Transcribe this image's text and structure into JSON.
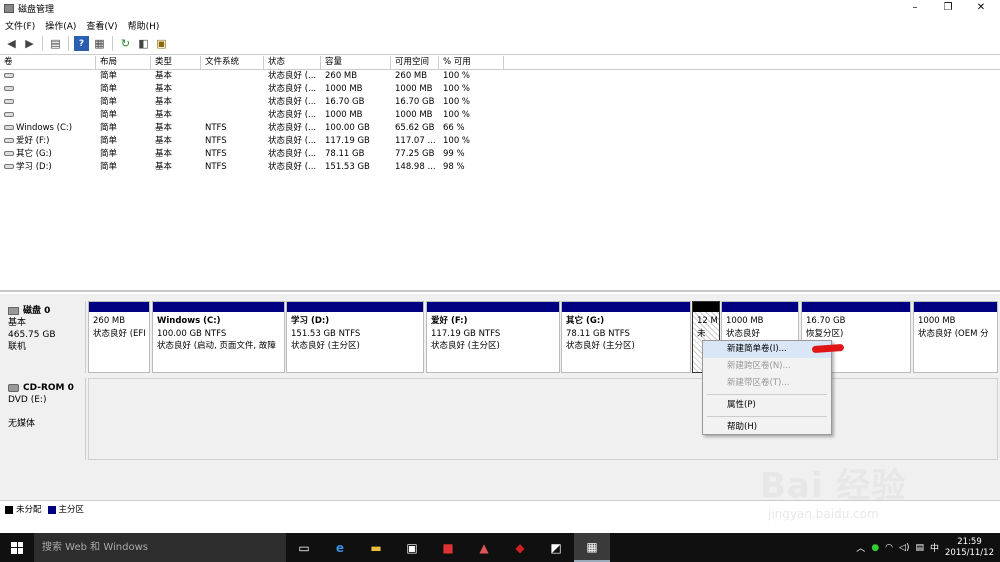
{
  "window": {
    "title": "磁盘管理",
    "minimize": "–",
    "maximize": "❐",
    "close": "✕"
  },
  "menu": [
    "文件(F)",
    "操作(A)",
    "查看(V)",
    "帮助(H)"
  ],
  "table": {
    "headers": [
      "卷",
      "布局",
      "类型",
      "文件系统",
      "状态",
      "容量",
      "可用空间",
      "% 可用"
    ],
    "rows": [
      [
        "",
        "简单",
        "基本",
        "",
        "状态良好 (...",
        "260 MB",
        "260 MB",
        "100 %"
      ],
      [
        "",
        "简单",
        "基本",
        "",
        "状态良好 (...",
        "1000 MB",
        "1000 MB",
        "100 %"
      ],
      [
        "",
        "简单",
        "基本",
        "",
        "状态良好 (...",
        "16.70 GB",
        "16.70 GB",
        "100 %"
      ],
      [
        "",
        "简单",
        "基本",
        "",
        "状态良好 (...",
        "1000 MB",
        "1000 MB",
        "100 %"
      ],
      [
        "Windows (C:)",
        "简单",
        "基本",
        "NTFS",
        "状态良好 (...",
        "100.00 GB",
        "65.62 GB",
        "66 %"
      ],
      [
        "爱好 (F:)",
        "简单",
        "基本",
        "NTFS",
        "状态良好 (...",
        "117.19 GB",
        "117.07 ...",
        "100 %"
      ],
      [
        "其它 (G:)",
        "简单",
        "基本",
        "NTFS",
        "状态良好 (...",
        "78.11 GB",
        "77.25 GB",
        "99 %"
      ],
      [
        "学习 (D:)",
        "简单",
        "基本",
        "NTFS",
        "状态良好 (...",
        "151.53 GB",
        "148.98 ...",
        "98 %"
      ]
    ]
  },
  "disk0": {
    "name": "磁盘 0",
    "type": "基本",
    "size": "465.75 GB",
    "status": "联机",
    "partitions": [
      {
        "label": "",
        "size": "260 MB",
        "status": "状态良好 (EFI"
      },
      {
        "label": "Windows  (C:)",
        "size": "100.00 GB NTFS",
        "status": "状态良好 (启动, 页面文件, 故障"
      },
      {
        "label": "学习  (D:)",
        "size": "151.53 GB NTFS",
        "status": "状态良好 (主分区)"
      },
      {
        "label": "爱好  (F:)",
        "size": "117.19 GB NTFS",
        "status": "状态良好 (主分区)"
      },
      {
        "label": "其它  (G:)",
        "size": "78.11 GB NTFS",
        "status": "状态良好 (主分区)"
      },
      {
        "label": "",
        "size": "12 M",
        "status": "未"
      },
      {
        "label": "",
        "size": "1000 MB",
        "status": "状态良好"
      },
      {
        "label": "",
        "size": "16.70 GB",
        "status": "恢复分区)"
      },
      {
        "label": "",
        "size": "1000 MB",
        "status": "状态良好 (OEM 分"
      }
    ]
  },
  "cdrom": {
    "name": "CD-ROM 0",
    "drive": "DVD (E:)",
    "status": "无媒体"
  },
  "legend": {
    "unallocated": "未分配",
    "primary": "主分区",
    "unalloc_color": "#000000",
    "primary_color": "#000080"
  },
  "context_menu": [
    {
      "label": "新建简单卷(I)...",
      "state": "highlighted"
    },
    {
      "label": "新建跨区卷(N)...",
      "state": "disabled"
    },
    {
      "label": "新建带区卷(T)...",
      "state": "disabled"
    },
    {
      "label": "属性(P)",
      "state": "normal"
    },
    {
      "label": "帮助(H)",
      "state": "normal"
    }
  ],
  "watermark": {
    "brand": "Bai 经验",
    "url": "jingyan.baidu.com"
  },
  "taskbar": {
    "search_placeholder": "搜索 Web 和 Windows",
    "ime": "中",
    "time": "21:59",
    "date": "2015/11/12"
  }
}
